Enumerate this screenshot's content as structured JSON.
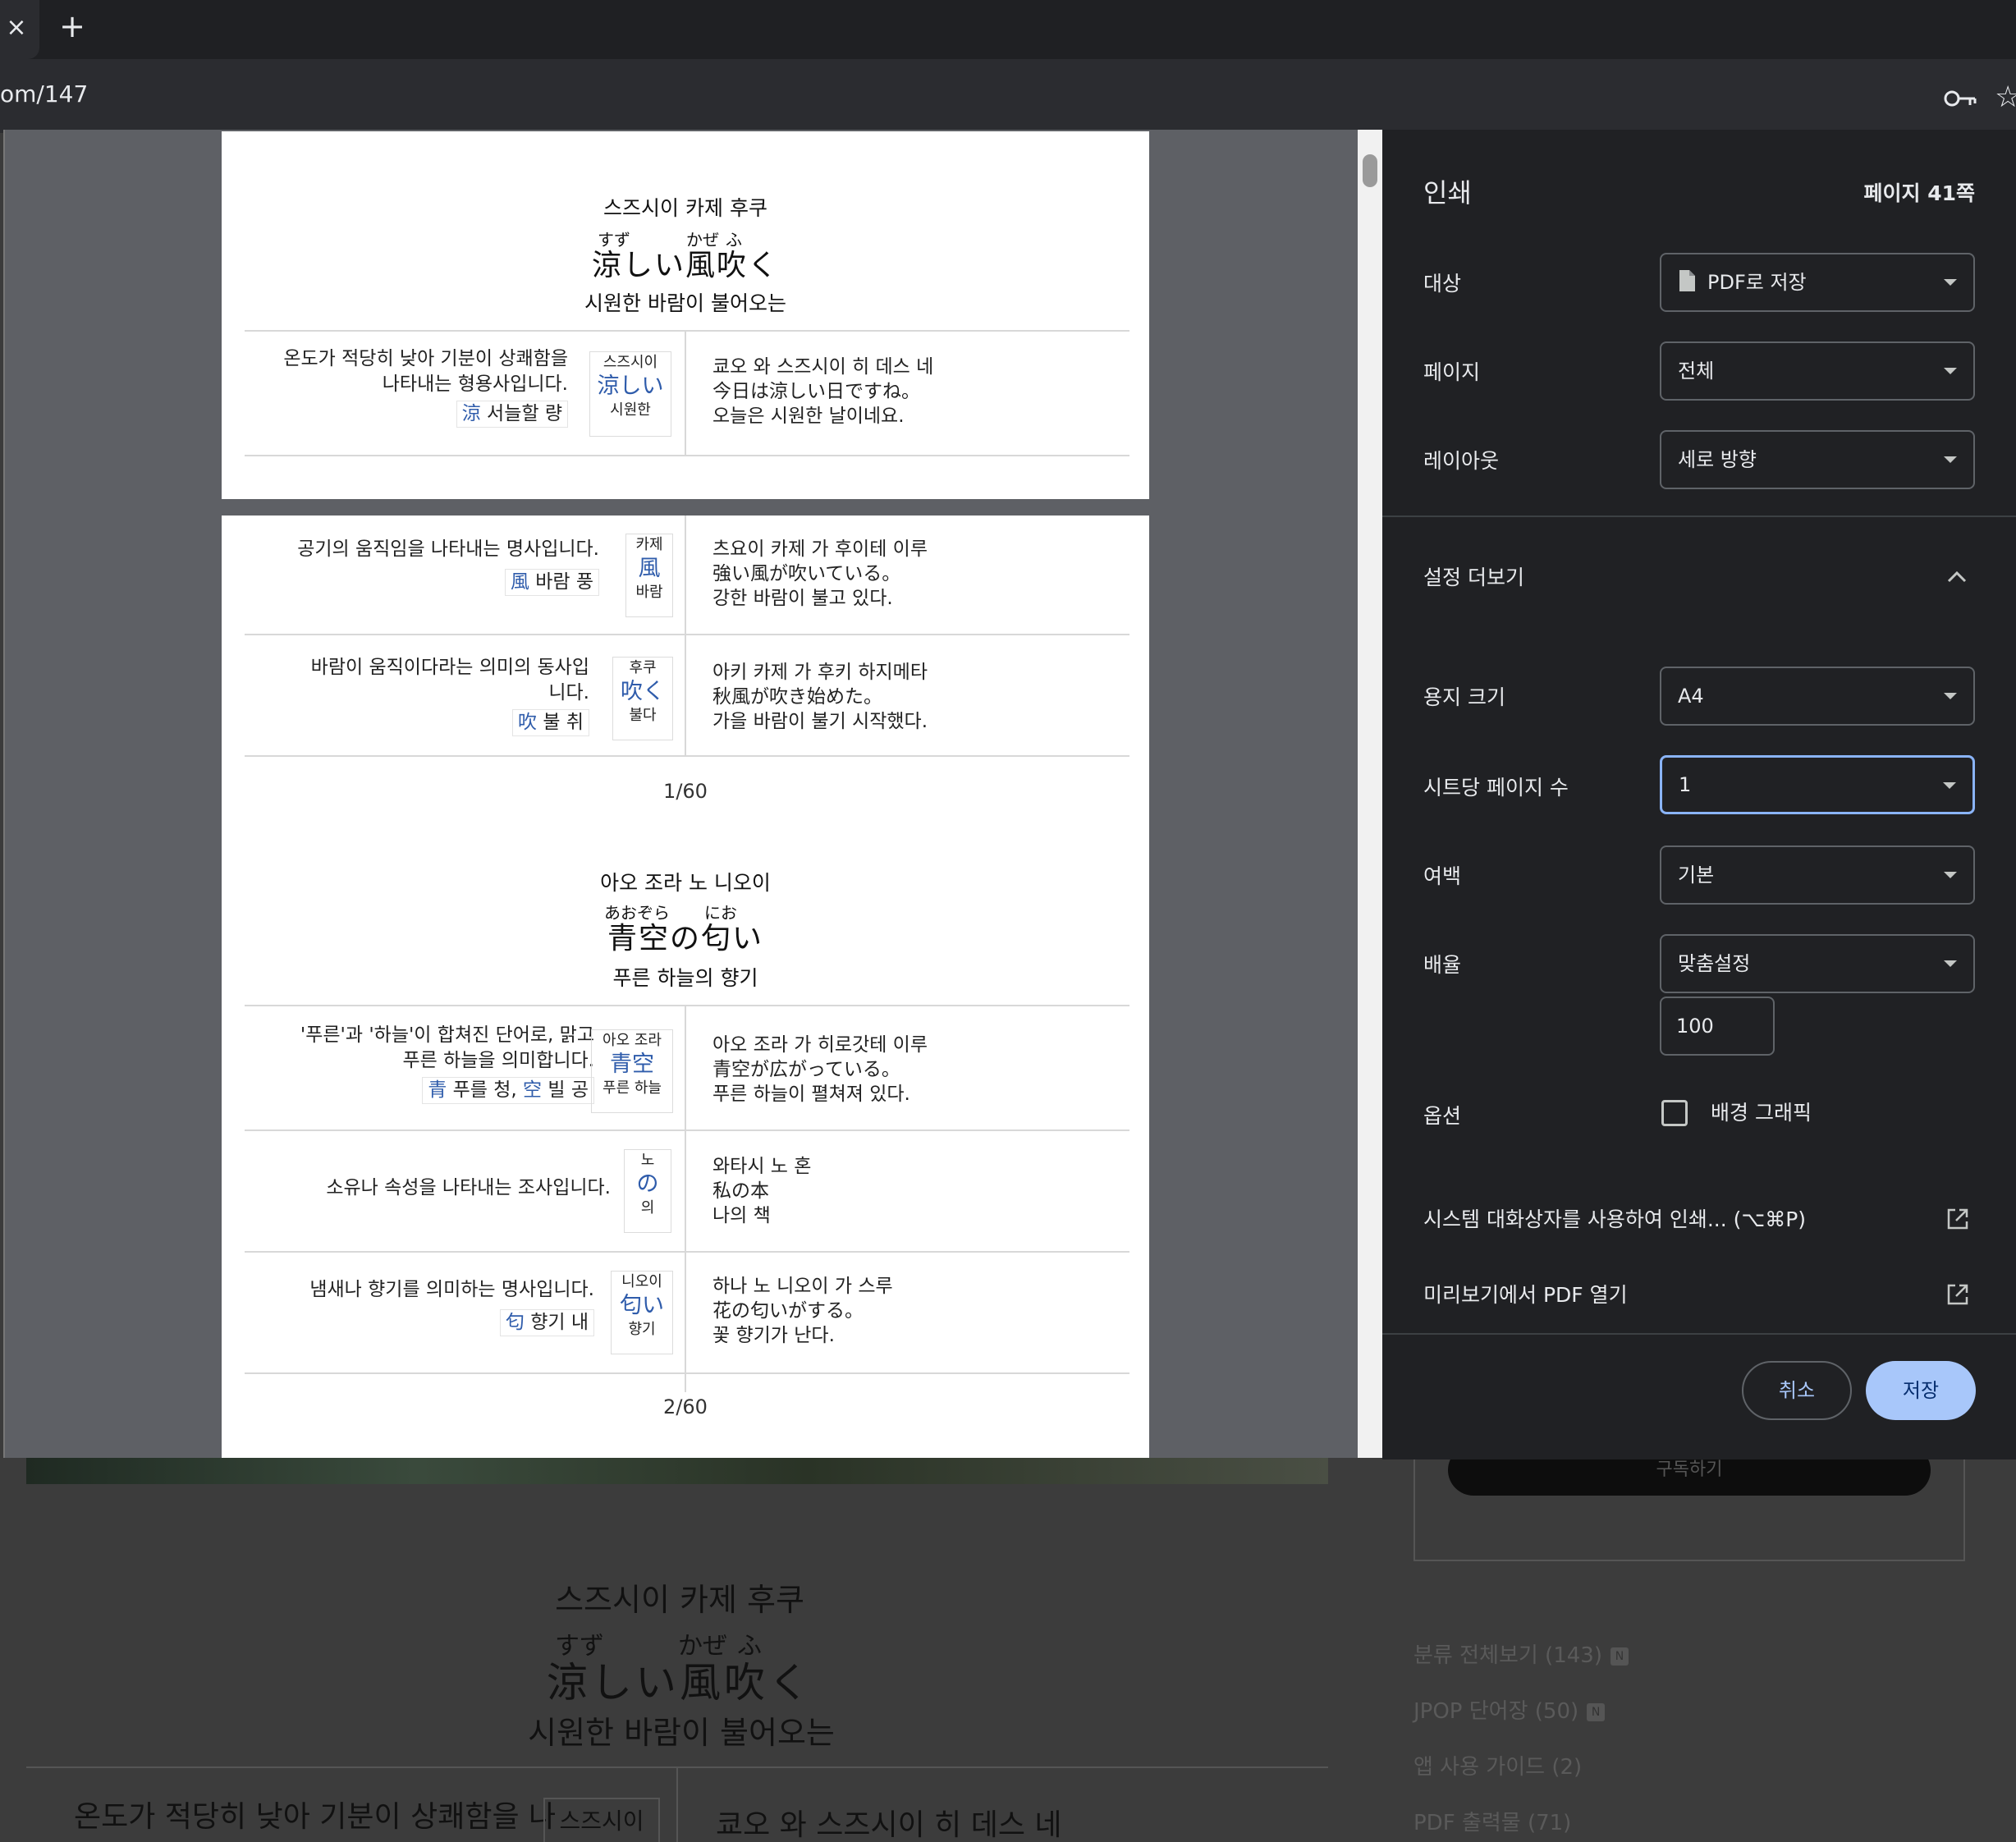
{
  "browser": {
    "tab_close": "×",
    "new_tab": "+",
    "url_fragment": "om/147"
  },
  "background_page": {
    "subscribe": "구독하기",
    "title": "스즈시이 카제 후쿠",
    "furigana": [
      "すず",
      "かぜ",
      "ふ"
    ],
    "japanese": "涼しい風吹く",
    "korean": "시원한 바람이 불어오는",
    "row_text": "온도가 적당히 낮아 기분이 상쾌함을 나",
    "row_badge": "스즈시이",
    "row_example": "쿄오 와 스즈시이 히 데스 네",
    "categories": [
      {
        "label": "분류 전체보기 (143)",
        "badge": "N"
      },
      {
        "label": "JPOP 단어장 (50)",
        "badge": "N"
      },
      {
        "label": "앱 사용 가이드 (2)",
        "badge": ""
      },
      {
        "label": "PDF 출력물 (71)",
        "badge": ""
      }
    ]
  },
  "preview": {
    "page1": {
      "title": "스즈시이 카제 후쿠",
      "furigana": [
        "すず",
        "かぜ",
        "ふ"
      ],
      "japanese": "涼しい風吹く",
      "korean": "시원한 바람이 불어오는",
      "entries": [
        {
          "definition_lines": [
            "온도가 적당히 낮아 기분이 상쾌함을",
            "나타내는 형용사입니다."
          ],
          "kanji": [
            {
              "char": "涼",
              "meaning": "서늘할 량"
            }
          ],
          "reading": "스즈시이",
          "word": "涼しい",
          "gloss": "시원한",
          "example": [
            "쿄오 와 스즈시이 히 데스 네",
            "今日は涼しい日ですね。",
            "오늘은 시원한 날이네요."
          ]
        }
      ]
    },
    "page2": {
      "entries": [
        {
          "definition_lines": [
            "공기의 움직임을 나타내는 명사입니다."
          ],
          "kanji": [
            {
              "char": "風",
              "meaning": "바람 풍"
            }
          ],
          "reading": "카제",
          "word": "風",
          "gloss": "바람",
          "example": [
            "츠요이 카제 가 후이테 이루",
            "強い風が吹いている。",
            "강한 바람이 불고 있다."
          ]
        },
        {
          "definition_lines": [
            "바람이 움직이다라는 의미의 동사입",
            "니다."
          ],
          "kanji": [
            {
              "char": "吹",
              "meaning": "불 취"
            }
          ],
          "reading": "후쿠",
          "word": "吹く",
          "gloss": "불다",
          "example": [
            "아키 카제 가 후키 하지메타",
            "秋風が吹き始めた。",
            "가을 바람이 불기 시작했다."
          ]
        }
      ],
      "page_number": "1/60",
      "title": "아오 조라 노 니오이",
      "furigana": [
        "あおぞら",
        "にお"
      ],
      "japanese": "青空の匂い",
      "korean": "푸른 하늘의 향기",
      "entries2": [
        {
          "definition_lines": [
            "'푸른'과 '하늘'이 합쳐진 단어로, 맑고",
            "푸른 하늘을 의미합니다."
          ],
          "kanji": [
            {
              "char": "青",
              "meaning": "푸를 청,"
            },
            {
              "char": "空",
              "meaning": "빌 공"
            }
          ],
          "reading": "아오 조라",
          "word": "青空",
          "gloss": "푸른 하늘",
          "example": [
            "아오 조라 가 히로갓테 이루",
            "青空が広がっている。",
            "푸른 하늘이 펼쳐져 있다."
          ]
        },
        {
          "definition_lines": [
            "소유나 속성을 나타내는 조사입니다."
          ],
          "kanji": [],
          "reading": "노",
          "word": "の",
          "gloss": "의",
          "example": [
            "와타시 노 혼",
            "私の本",
            "나의 책"
          ]
        },
        {
          "definition_lines": [
            "냄새나 향기를 의미하는 명사입니다."
          ],
          "kanji": [
            {
              "char": "匂",
              "meaning": "향기 내"
            }
          ],
          "reading": "니오이",
          "word": "匂い",
          "gloss": "향기",
          "example": [
            "하나 노 니오이 가 스루",
            "花の匂いがする。",
            "꽃 향기가 난다."
          ]
        }
      ],
      "page_number2": "2/60"
    }
  },
  "print_panel": {
    "title": "인쇄",
    "page_count": "페이지 41쪽",
    "destination_label": "대상",
    "destination_value": "PDF로 저장",
    "pages_label": "페이지",
    "pages_value": "전체",
    "layout_label": "레이아웃",
    "layout_value": "세로 방향",
    "more_settings": "설정 더보기",
    "paper_size_label": "용지 크기",
    "paper_size_value": "A4",
    "pages_per_sheet_label": "시트당 페이지 수",
    "pages_per_sheet_value": "1",
    "margins_label": "여백",
    "margins_value": "기본",
    "scale_label": "배율",
    "scale_value": "맞춤설정",
    "scale_input": "100",
    "options_label": "옵션",
    "background_graphics": "배경 그래픽",
    "background_graphics_checked": false,
    "system_dialog": "시스템 대화상자를 사용하여 인쇄... (⌥⌘P)",
    "open_pdf": "미리보기에서 PDF 열기",
    "cancel": "취소",
    "save": "저장",
    "accent": "#a8c7fa"
  }
}
